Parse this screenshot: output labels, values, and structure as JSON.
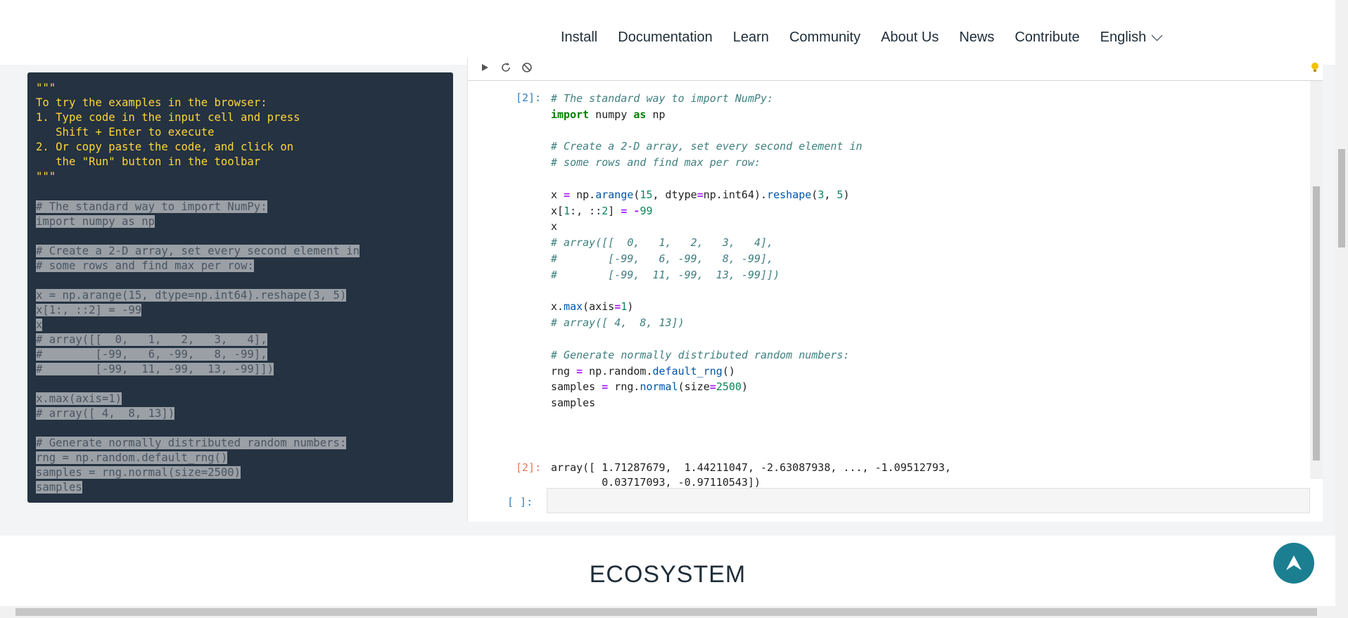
{
  "nav": {
    "items": [
      "Install",
      "Documentation",
      "Learn",
      "Community",
      "About Us",
      "News",
      "Contribute"
    ],
    "language": "English"
  },
  "left_panel": {
    "doc_text": "\"\"\"\nTo try the examples in the browser:\n1. Type code in the input cell and press\n   Shift + Enter to execute\n2. Or copy paste the code, and click on\n   the \"Run\" button in the toolbar\n\"\"\"",
    "selected_lines": [
      "# The standard way to import NumPy:",
      "import numpy as np",
      "",
      "# Create a 2-D array, set every second element in",
      "# some rows and find max per row:",
      "",
      "x = np.arange(15, dtype=np.int64).reshape(3, 5)",
      "x[1:, ::2] = -99",
      "x",
      "# array([[  0,   1,   2,   3,   4],",
      "#        [-99,   6, -99,   8, -99],",
      "#        [-99,  11, -99,  13, -99]])",
      "",
      "x.max(axis=1)",
      "# array([ 4,  8, 13])",
      "",
      "# Generate normally distributed random numbers:",
      "rng = np.random.default_rng()",
      "samples = rng.normal(size=2500)",
      "samples"
    ]
  },
  "notebook": {
    "in_prompt": "[2]:",
    "out_prompt": "[2]:",
    "empty_prompt": "[ ]:",
    "output_text": "array([ 1.71287679,  1.44211047, -2.63087938, ..., -1.09512793,\n        0.03717093, -0.97110543])"
  },
  "section": {
    "title": "ECOSYSTEM"
  }
}
